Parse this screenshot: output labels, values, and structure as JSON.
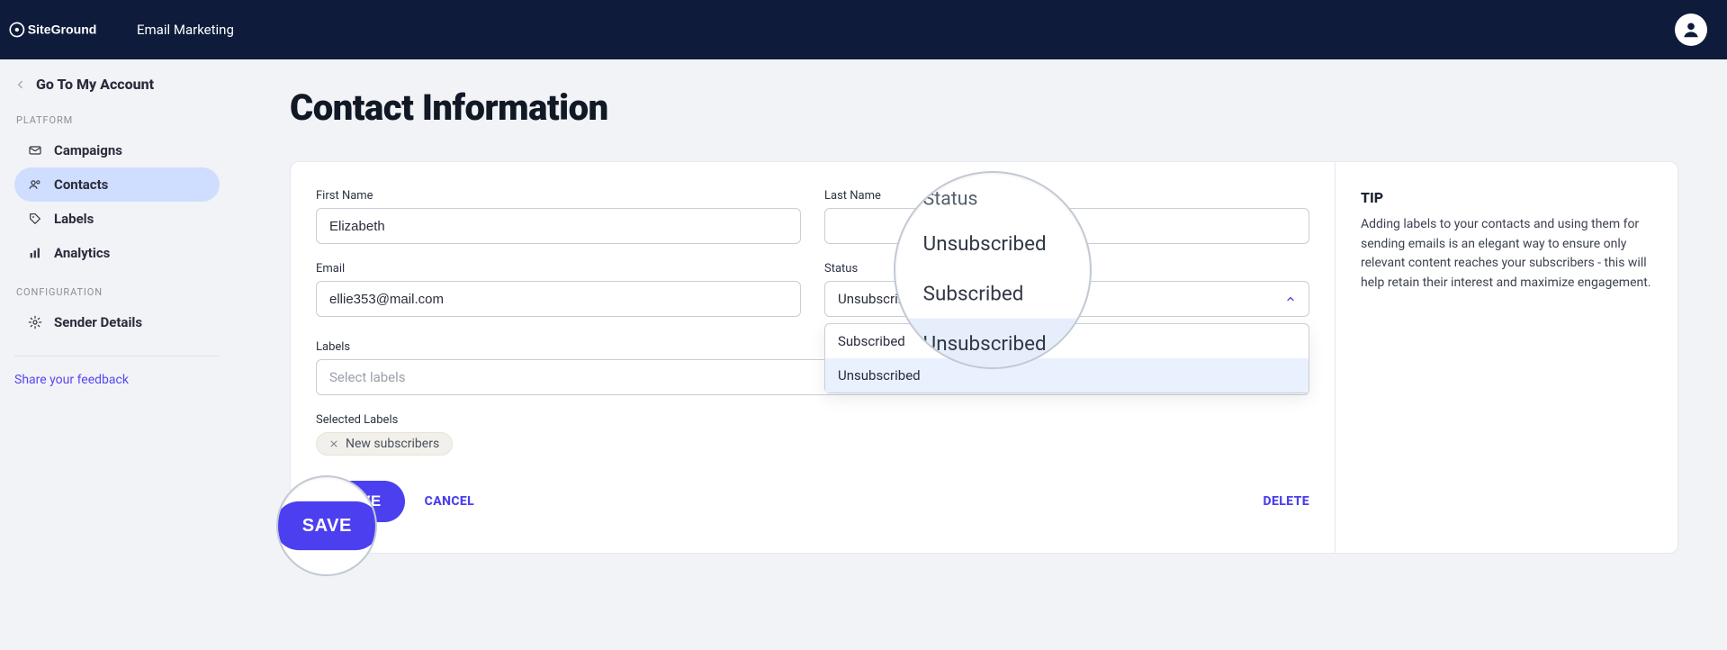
{
  "header": {
    "app_name": "Email Marketing"
  },
  "sidebar": {
    "back_label": "Go To My Account",
    "section_platform": "PLATFORM",
    "section_config": "CONFIGURATION",
    "items": [
      {
        "label": "Campaigns"
      },
      {
        "label": "Contacts"
      },
      {
        "label": "Labels"
      },
      {
        "label": "Analytics"
      }
    ],
    "config_items": [
      {
        "label": "Sender Details"
      }
    ],
    "feedback_label": "Share your feedback"
  },
  "page": {
    "title": "Contact Information"
  },
  "form": {
    "first_name_label": "First Name",
    "first_name_value": "Elizabeth",
    "last_name_label": "Last Name",
    "last_name_value": "",
    "email_label": "Email",
    "email_value": "ellie353@mail.com",
    "status_label": "Status",
    "status_value": "Unsubscribed",
    "status_options": [
      "Subscribed",
      "Unsubscribed"
    ],
    "labels_label": "Labels",
    "labels_placeholder": "Select labels",
    "selected_labels_label": "Selected Labels",
    "selected_labels": [
      "New subscribers"
    ],
    "save_label": "SAVE",
    "cancel_label": "CANCEL",
    "delete_label": "DELETE"
  },
  "tip": {
    "title": "TIP",
    "body": "Adding labels to your contacts and using them for sending emails is an elegant way to ensure only relevant content reaches your subscribers - this will help retain their interest and maximize engagement."
  },
  "colors": {
    "accent": "#4c3fef",
    "navy": "#0e1b3a",
    "active_nav": "#cfddff"
  }
}
